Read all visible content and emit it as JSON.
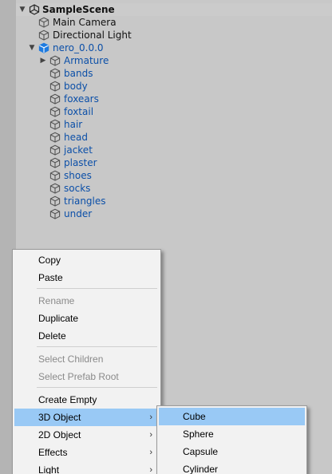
{
  "scene": {
    "name": "SampleScene"
  },
  "hierarchy": {
    "root_items": [
      "Main Camera",
      "Directional Light"
    ],
    "prefab": {
      "name": "nero_0.0.0"
    },
    "children": [
      "Armature",
      "bands",
      "body",
      "foxears",
      "foxtail",
      "hair",
      "head",
      "jacket",
      "plaster",
      "shoes",
      "socks",
      "triangles",
      "under"
    ]
  },
  "context_menu": {
    "copy": "Copy",
    "paste": "Paste",
    "rename": "Rename",
    "duplicate": "Duplicate",
    "delete": "Delete",
    "select_children": "Select Children",
    "select_prefab_root": "Select Prefab Root",
    "create_empty": "Create Empty",
    "object_3d": "3D Object",
    "object_2d": "2D Object",
    "effects": "Effects",
    "light": "Light",
    "submenu_arrow": "›"
  },
  "submenu_3d": {
    "cube": "Cube",
    "sphere": "Sphere",
    "capsule": "Capsule",
    "cylinder": "Cylinder"
  },
  "icons": {
    "scene": "unity-scene-icon",
    "gameobject": "gameobject-cube-icon",
    "prefab": "prefab-cube-icon",
    "expand_open": "▼",
    "expand_closed": "▶"
  },
  "colors": {
    "highlight": "#99c9f5",
    "prefab_text": "#0b4fa8",
    "prefab_icon": "#1e7be0"
  }
}
